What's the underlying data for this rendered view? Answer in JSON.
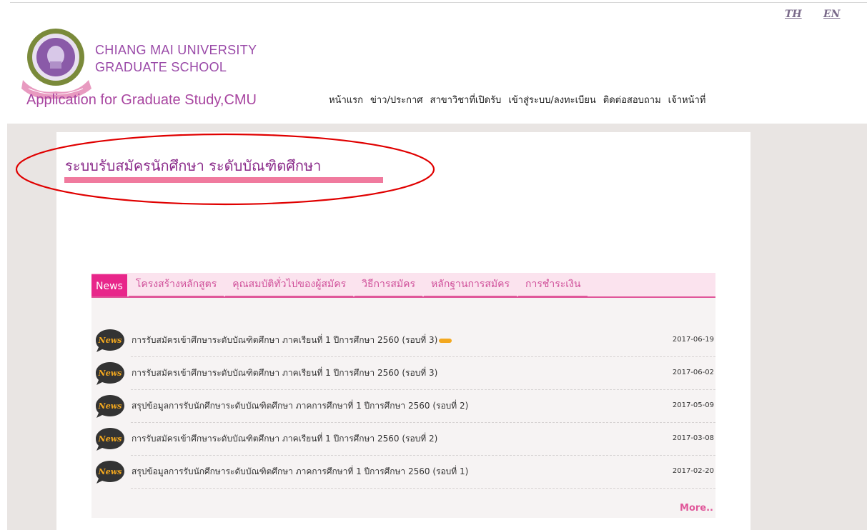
{
  "language": {
    "th": "TH",
    "en": "EN"
  },
  "brand": {
    "line1": "CHIANG MAI UNIVERSITY",
    "line2": "GRADUATE SCHOOL",
    "app_title": "Application for Graduate Study,CMU",
    "logo_icon": "university-seal-icon"
  },
  "nav": {
    "items": [
      {
        "label": "หน้าแรก"
      },
      {
        "label": "ข่าว/ประกาศ"
      },
      {
        "label": "สาขาวิชาที่เปิดรับ"
      },
      {
        "label": "เข้าสู่ระบบ/ลงทะเบียน"
      },
      {
        "label": "ติดต่อสอบถาม"
      },
      {
        "label": "เจ้าหน้าที่"
      }
    ]
  },
  "page": {
    "heading": "ระบบรับสมัครนักศึกษา ระดับบัณฑิตศึกษา"
  },
  "tabs": [
    {
      "label": "News",
      "active": true
    },
    {
      "label": "โครงสร้างหลักสูตร"
    },
    {
      "label": "คุณสมบัติทั่วไปของผู้สมัคร"
    },
    {
      "label": "วิธีการสมัคร"
    },
    {
      "label": "หลักฐานการสมัคร"
    },
    {
      "label": "การชำระเงิน"
    }
  ],
  "news": {
    "icon_label": "News",
    "items": [
      {
        "title": "การรับสมัครเข้าศึกษาระดับบัณฑิตศึกษา ภาคเรียนที่ 1 ปีการศึกษา 2560 (รอบที่ 3)",
        "date": "2017-06-19",
        "is_new": true
      },
      {
        "title": "การรับสมัครเข้าศึกษาระดับบัณฑิตศึกษา ภาคเรียนที่ 1 ปีการศึกษา 2560 (รอบที่ 3)",
        "date": "2017-06-02"
      },
      {
        "title": "สรุปข้อมูลการรับนักศึกษาระดับบัณฑิตศึกษา ภาคการศึกษาที่ 1 ปีการศึกษา 2560 (รอบที่ 2)",
        "date": "2017-05-09"
      },
      {
        "title": "การรับสมัครเข้าศึกษาระดับบัณฑิตศึกษา ภาคเรียนที่ 1 ปีการศึกษา 2560 (รอบที่ 2)",
        "date": "2017-03-08"
      },
      {
        "title": "สรุปข้อมูลการรับนักศึกษาระดับบัณฑิตศึกษา ภาคการศึกษาที่ 1 ปีการศึกษา 2560 (รอบที่ 1)",
        "date": "2017-02-20"
      }
    ],
    "more_label": "More.."
  },
  "colors": {
    "brand_purple": "#9a4aa8",
    "accent_pink": "#e8268a",
    "heading_bar": "#f07a9e",
    "annotation_red": "#e00000"
  }
}
